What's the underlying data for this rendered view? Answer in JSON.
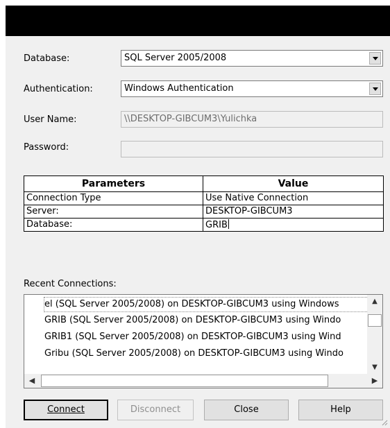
{
  "form": {
    "database_label": "Database:",
    "database_value": "SQL Server 2005/2008",
    "authentication_label": "Authentication:",
    "authentication_value": "Windows Authentication",
    "username_label": "User Name:",
    "username_value": "\\\\DESKTOP-GIBCUM3\\Yulichka",
    "password_label": "Password:",
    "password_value": ""
  },
  "params": {
    "headers": [
      "Parameters",
      "Value"
    ],
    "rows": [
      {
        "name": "Connection Type",
        "value": "Use Native Connection"
      },
      {
        "name": "Server:",
        "value": "DESKTOP-GIBCUM3"
      },
      {
        "name": "Database:",
        "value": "GRIB"
      }
    ]
  },
  "recent": {
    "label": "Recent Connections:",
    "items": [
      "el (SQL Server 2005/2008) on DESKTOP-GIBCUM3 using Windows",
      "GRIB (SQL Server 2005/2008) on DESKTOP-GIBCUM3 using Windo",
      "GRIB1 (SQL Server 2005/2008) on DESKTOP-GIBCUM3 using Wind",
      "Gribu (SQL Server 2005/2008) on DESKTOP-GIBCUM3 using Windo"
    ]
  },
  "buttons": {
    "connect": "Connect",
    "disconnect": "Disconnect",
    "close": "Close",
    "help": "Help"
  },
  "icons": {
    "dropdown": "chevron-down-icon",
    "scroll_up": "scroll-up-arrow-icon",
    "scroll_down": "scroll-down-arrow-icon",
    "scroll_left": "scroll-left-arrow-icon",
    "scroll_right": "scroll-right-arrow-icon",
    "resize": "resize-grip-icon"
  }
}
